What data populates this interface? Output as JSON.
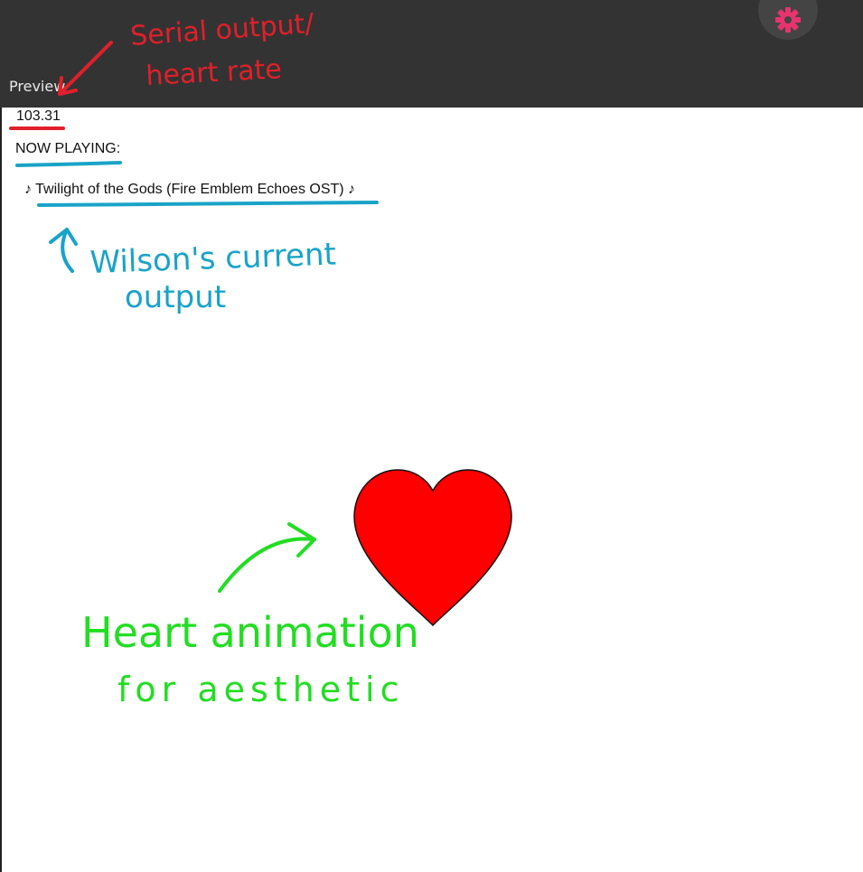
{
  "header": {
    "title": "Preview",
    "settings_icon": "gear-icon"
  },
  "output": {
    "heart_rate": "103.31",
    "now_playing_label": "NOW PLAYING:",
    "track": "♪ Twilight of the Gods (Fire Emblem Echoes OST) ♪"
  },
  "annotations": {
    "serial_line1": "Serial output/",
    "serial_line2": "heart rate",
    "wilson_line1": "Wilson's current",
    "wilson_line2": "output",
    "heart_line1": "Heart animation",
    "heart_line2": "for aesthetic"
  },
  "colors": {
    "topbar": "#333333",
    "gear": "#e8336f",
    "heart_fill": "#ff0000",
    "annotation_red": "#e0202a",
    "annotation_blue": "#1aa3c8",
    "annotation_green": "#22dd22"
  }
}
